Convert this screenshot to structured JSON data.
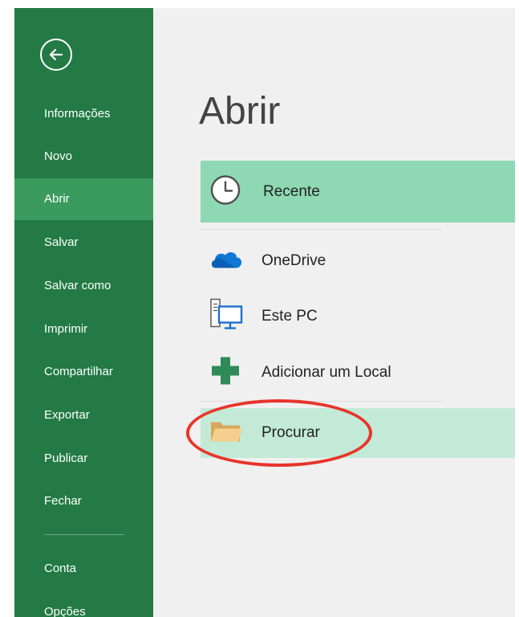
{
  "sidebar": {
    "items": [
      {
        "label": "Informações"
      },
      {
        "label": "Novo"
      },
      {
        "label": "Abrir"
      },
      {
        "label": "Salvar"
      },
      {
        "label": "Salvar como"
      },
      {
        "label": "Imprimir"
      },
      {
        "label": "Compartilhar"
      },
      {
        "label": "Exportar"
      },
      {
        "label": "Publicar"
      },
      {
        "label": "Fechar"
      },
      {
        "label": "Conta"
      },
      {
        "label": "Opções"
      }
    ],
    "active_item": "Abrir"
  },
  "main": {
    "title": "Abrir",
    "locations": [
      {
        "label": "Recente",
        "icon": "clock-icon"
      },
      {
        "label": "OneDrive",
        "icon": "cloud-icon"
      },
      {
        "label": "Este PC",
        "icon": "computer-icon"
      },
      {
        "label": "Adicionar um Local",
        "icon": "plus-icon"
      },
      {
        "label": "Procurar",
        "icon": "folder-icon"
      }
    ]
  },
  "colors": {
    "sidebar_bg": "#237a45",
    "sidebar_active": "#3b9a5e",
    "recent_highlight": "#8ed8b4",
    "browse_highlight": "#c3ead6",
    "annotation": "#e8352b"
  }
}
